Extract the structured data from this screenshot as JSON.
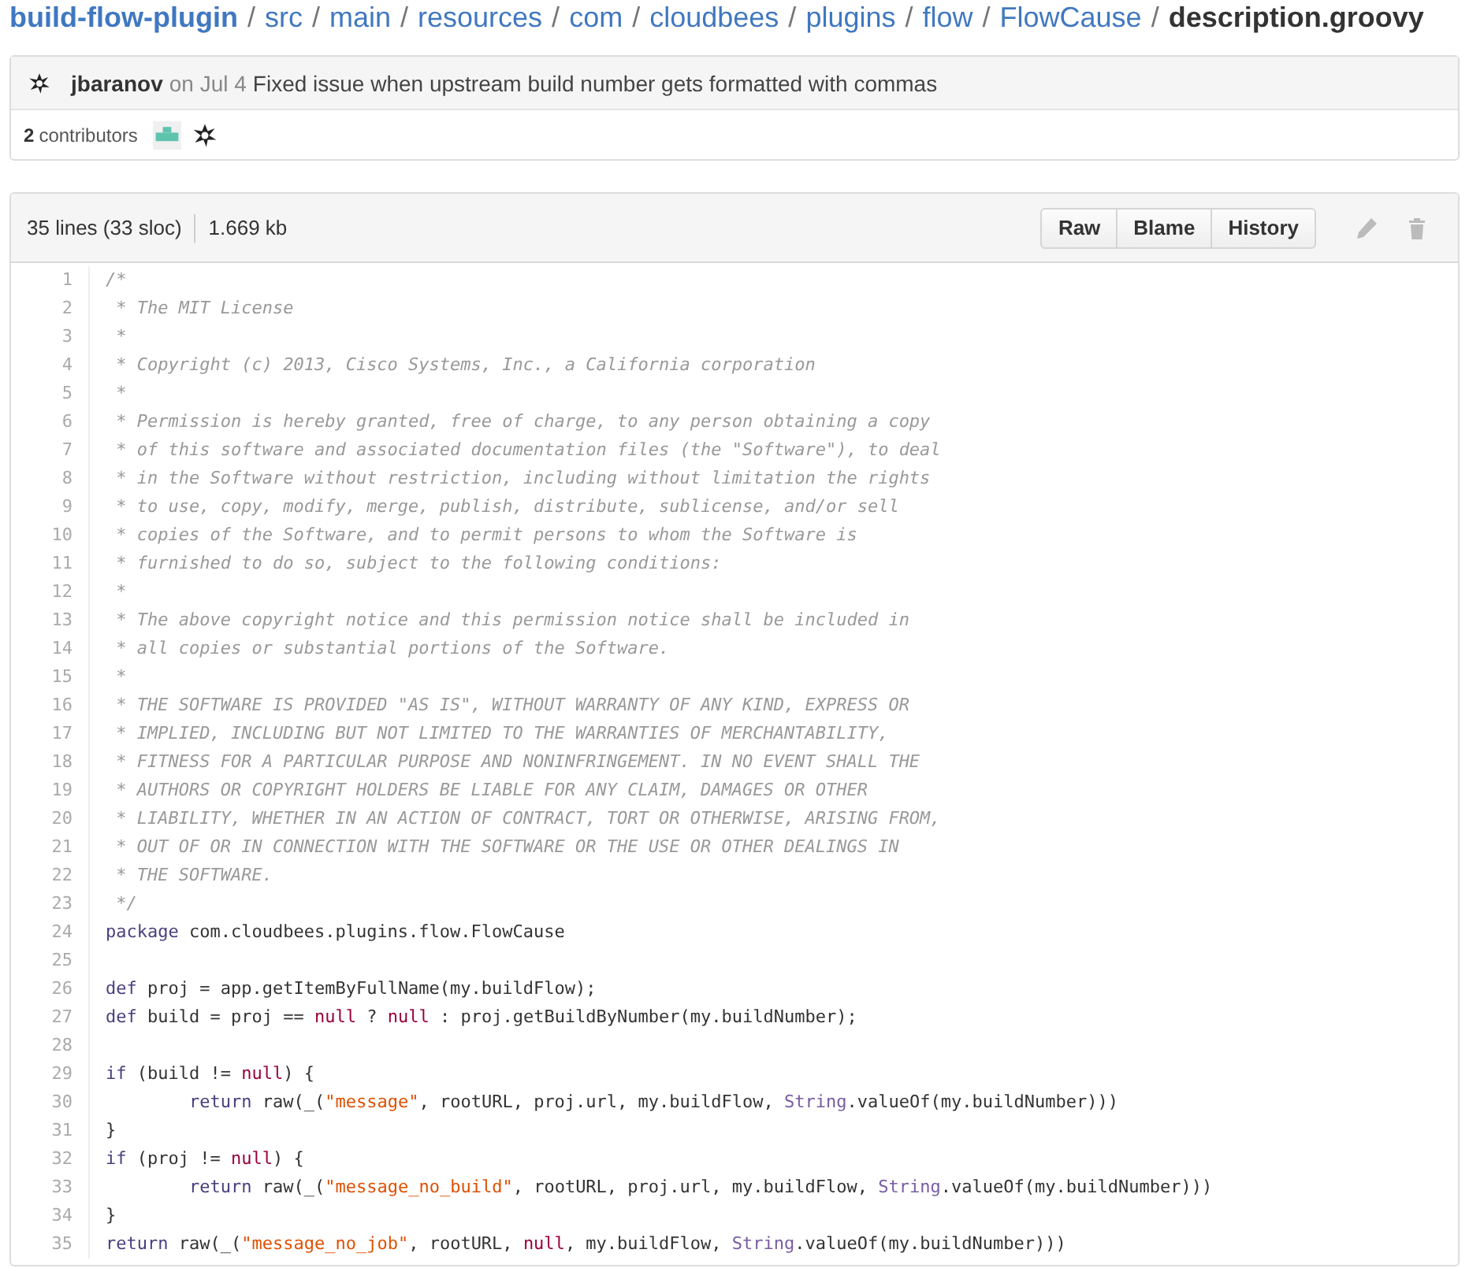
{
  "breadcrumb": [
    {
      "label": "build-flow-plugin",
      "kind": "repo"
    },
    {
      "label": "src",
      "kind": "dir"
    },
    {
      "label": "main",
      "kind": "dir"
    },
    {
      "label": "resources",
      "kind": "dir"
    },
    {
      "label": "com",
      "kind": "dir"
    },
    {
      "label": "cloudbees",
      "kind": "dir"
    },
    {
      "label": "plugins",
      "kind": "dir"
    },
    {
      "label": "flow",
      "kind": "dir"
    },
    {
      "label": "FlowCause",
      "kind": "dir"
    },
    {
      "label": "description.groovy",
      "kind": "file"
    }
  ],
  "separator": "/",
  "commit": {
    "author": "jbaranov",
    "date": "on Jul 4",
    "message": "Fixed issue when upstream build number gets formatted with commas"
  },
  "contributors": {
    "count": "2",
    "label": "contributors"
  },
  "file": {
    "lines": "35 lines (33 sloc)",
    "size": "1.669 kb",
    "buttons": [
      "Raw",
      "Blame",
      "History"
    ]
  },
  "code": [
    {
      "number": "1",
      "tokens": [
        {
          "t": "/*",
          "kind": "comment"
        }
      ]
    },
    {
      "number": "2",
      "tokens": [
        {
          "t": " * The MIT License",
          "kind": "comment"
        }
      ]
    },
    {
      "number": "3",
      "tokens": [
        {
          "t": " *",
          "kind": "comment"
        }
      ]
    },
    {
      "number": "4",
      "tokens": [
        {
          "t": " * Copyright (c) 2013, Cisco Systems, Inc., a California corporation",
          "kind": "comment"
        }
      ]
    },
    {
      "number": "5",
      "tokens": [
        {
          "t": " *",
          "kind": "comment"
        }
      ]
    },
    {
      "number": "6",
      "tokens": [
        {
          "t": " * Permission is hereby granted, free of charge, to any person obtaining a copy",
          "kind": "comment"
        }
      ]
    },
    {
      "number": "7",
      "tokens": [
        {
          "t": " * of this software and associated documentation files (the \"Software\"), to deal",
          "kind": "comment"
        }
      ]
    },
    {
      "number": "8",
      "tokens": [
        {
          "t": " * in the Software without restriction, including without limitation the rights",
          "kind": "comment"
        }
      ]
    },
    {
      "number": "9",
      "tokens": [
        {
          "t": " * to use, copy, modify, merge, publish, distribute, sublicense, and/or sell",
          "kind": "comment"
        }
      ]
    },
    {
      "number": "10",
      "tokens": [
        {
          "t": " * copies of the Software, and to permit persons to whom the Software is",
          "kind": "comment"
        }
      ]
    },
    {
      "number": "11",
      "tokens": [
        {
          "t": " * furnished to do so, subject to the following conditions:",
          "kind": "comment"
        }
      ]
    },
    {
      "number": "12",
      "tokens": [
        {
          "t": " *",
          "kind": "comment"
        }
      ]
    },
    {
      "number": "13",
      "tokens": [
        {
          "t": " * The above copyright notice and this permission notice shall be included in",
          "kind": "comment"
        }
      ]
    },
    {
      "number": "14",
      "tokens": [
        {
          "t": " * all copies or substantial portions of the Software.",
          "kind": "comment"
        }
      ]
    },
    {
      "number": "15",
      "tokens": [
        {
          "t": " *",
          "kind": "comment"
        }
      ]
    },
    {
      "number": "16",
      "tokens": [
        {
          "t": " * THE SOFTWARE IS PROVIDED \"AS IS\", WITHOUT WARRANTY OF ANY KIND, EXPRESS OR",
          "kind": "comment"
        }
      ]
    },
    {
      "number": "17",
      "tokens": [
        {
          "t": " * IMPLIED, INCLUDING BUT NOT LIMITED TO THE WARRANTIES OF MERCHANTABILITY,",
          "kind": "comment"
        }
      ]
    },
    {
      "number": "18",
      "tokens": [
        {
          "t": " * FITNESS FOR A PARTICULAR PURPOSE AND NONINFRINGEMENT. IN NO EVENT SHALL THE",
          "kind": "comment"
        }
      ]
    },
    {
      "number": "19",
      "tokens": [
        {
          "t": " * AUTHORS OR COPYRIGHT HOLDERS BE LIABLE FOR ANY CLAIM, DAMAGES OR OTHER",
          "kind": "comment"
        }
      ]
    },
    {
      "number": "20",
      "tokens": [
        {
          "t": " * LIABILITY, WHETHER IN AN ACTION OF CONTRACT, TORT OR OTHERWISE, ARISING FROM,",
          "kind": "comment"
        }
      ]
    },
    {
      "number": "21",
      "tokens": [
        {
          "t": " * OUT OF OR IN CONNECTION WITH THE SOFTWARE OR THE USE OR OTHER DEALINGS IN",
          "kind": "comment"
        }
      ]
    },
    {
      "number": "22",
      "tokens": [
        {
          "t": " * THE SOFTWARE.",
          "kind": "comment"
        }
      ]
    },
    {
      "number": "23",
      "tokens": [
        {
          "t": " */",
          "kind": "comment"
        }
      ]
    },
    {
      "number": "24",
      "tokens": [
        {
          "t": "package",
          "kind": "keyword"
        },
        {
          "t": " com.cloudbees.plugins.flow.FlowCause",
          "kind": "plain"
        }
      ]
    },
    {
      "number": "25"
    },
    {
      "number": "26",
      "tokens": [
        {
          "t": "def",
          "kind": "keyword"
        },
        {
          "t": " proj = app.getItemByFullName(my.buildFlow);",
          "kind": "plain"
        }
      ]
    },
    {
      "number": "27",
      "tokens": [
        {
          "t": "def",
          "kind": "keyword"
        },
        {
          "t": " build = proj == ",
          "kind": "plain"
        },
        {
          "t": "null",
          "kind": "constant"
        },
        {
          "t": " ? ",
          "kind": "plain"
        },
        {
          "t": "null",
          "kind": "constant"
        },
        {
          "t": " : proj.getBuildByNumber(my.buildNumber);",
          "kind": "plain"
        }
      ]
    },
    {
      "number": "28"
    },
    {
      "number": "29",
      "tokens": [
        {
          "t": "if",
          "kind": "keyword"
        },
        {
          "t": " (build != ",
          "kind": "plain"
        },
        {
          "t": "null",
          "kind": "constant"
        },
        {
          "t": ") {",
          "kind": "plain"
        }
      ]
    },
    {
      "number": "30",
      "indented": true,
      "tokens": [
        {
          "t": "return",
          "kind": "keyword"
        },
        {
          "t": " raw(_(",
          "kind": "plain"
        },
        {
          "t": "\"message\"",
          "kind": "string"
        },
        {
          "t": ", rootURL, proj.url, my.buildFlow, ",
          "kind": "plain"
        },
        {
          "t": "String",
          "kind": "type"
        },
        {
          "t": ".valueOf(my.buildNumber)))",
          "kind": "plain"
        }
      ]
    },
    {
      "number": "31",
      "tokens": [
        {
          "t": "}",
          "kind": "plain"
        }
      ]
    },
    {
      "number": "32",
      "tokens": [
        {
          "t": "if",
          "kind": "keyword"
        },
        {
          "t": " (proj != ",
          "kind": "plain"
        },
        {
          "t": "null",
          "kind": "constant"
        },
        {
          "t": ") {",
          "kind": "plain"
        }
      ]
    },
    {
      "number": "33",
      "indented": true,
      "tokens": [
        {
          "t": "return",
          "kind": "keyword"
        },
        {
          "t": " raw(_(",
          "kind": "plain"
        },
        {
          "t": "\"message_no_build\"",
          "kind": "string"
        },
        {
          "t": ", rootURL, proj.url, my.buildFlow, ",
          "kind": "plain"
        },
        {
          "t": "String",
          "kind": "type"
        },
        {
          "t": ".valueOf(my.buildNumber)))",
          "kind": "plain"
        }
      ]
    },
    {
      "number": "34",
      "tokens": [
        {
          "t": "}",
          "kind": "plain"
        }
      ]
    },
    {
      "number": "35",
      "tokens": [
        {
          "t": "return",
          "kind": "keyword"
        },
        {
          "t": " raw(_(",
          "kind": "plain"
        },
        {
          "t": "\"message_no_job\"",
          "kind": "string"
        },
        {
          "t": ", rootURL, ",
          "kind": "plain"
        },
        {
          "t": "null",
          "kind": "constant"
        },
        {
          "t": ", my.buildFlow, ",
          "kind": "plain"
        },
        {
          "t": "String",
          "kind": "type"
        },
        {
          "t": ".valueOf(my.buildNumber)))",
          "kind": "plain"
        }
      ]
    }
  ]
}
